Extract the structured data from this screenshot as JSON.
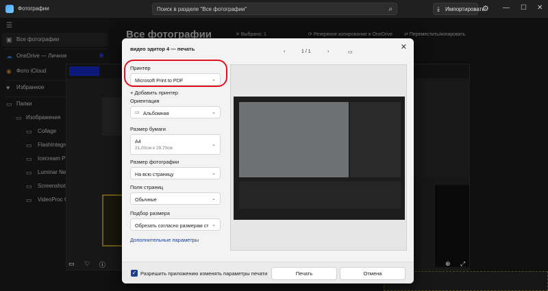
{
  "app": {
    "title": "Фотографии"
  },
  "search": {
    "placeholder": "Поиск в разделе \"Все фотографии\""
  },
  "toolbar": {
    "import_label": "Импортировать"
  },
  "sidebar": {
    "items": [
      {
        "label": "Все фотографии"
      },
      {
        "label": "OneDrive — Личное"
      },
      {
        "label": "Фото iCloud"
      },
      {
        "label": "Избранное"
      },
      {
        "label": "Папки"
      },
      {
        "label": "Изображения"
      },
      {
        "label": "Collage"
      },
      {
        "label": "FlashIntegro"
      },
      {
        "label": "Icecream Pho"
      },
      {
        "label": "Luminar Neo"
      },
      {
        "label": "Screenshots"
      },
      {
        "label": "VideoProc Co"
      }
    ]
  },
  "main": {
    "title": "Все фотографии",
    "selected": "Выбрано: 1",
    "backup": "Резервное копирование в OneDrive",
    "move_copy": "Переместить/копировать"
  },
  "dialog": {
    "title": "видео эдитор 4 — печать",
    "page_indicator": "1 / 1",
    "printer_label": "Принтер",
    "printer_value": "Microsoft Print to PDF",
    "add_printer": "Добавить принтер",
    "orientation_label": "Ориентация",
    "orientation_value": "Альбомная",
    "paper_label": "Размер бумаги",
    "paper_value": "A4",
    "paper_sub": "21,00см x 29,70см",
    "photo_size_label": "Размер фотографии",
    "photo_size_value": "На всю страницу",
    "margins_label": "Поля страниц",
    "margins_value": "Обычные",
    "fit_label": "Подбор размера",
    "fit_value": "Обрезать согласно размерам стра",
    "more_settings": "Дополнительные параметры",
    "allow_change": "Разрешить приложению изменять параметры печати",
    "print_button": "Печать",
    "cancel_button": "Отмена"
  },
  "icons": {
    "app": "photos-app-icon",
    "search": "search-icon",
    "import": "import-icon",
    "settings": "gear-icon",
    "close": "close-icon"
  }
}
